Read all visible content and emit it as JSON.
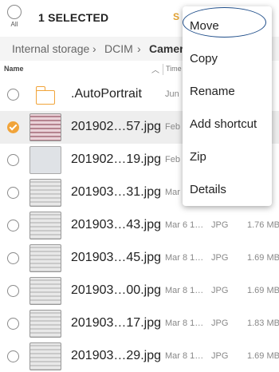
{
  "header": {
    "all_label": "All",
    "selected_text": "1 SELECTED",
    "share_partial": "S"
  },
  "breadcrumb": {
    "items": [
      "Internal storage",
      "DCIM",
      "Camer"
    ],
    "separator": "›"
  },
  "columns": {
    "name": "Name",
    "time": "Time"
  },
  "files": [
    {
      "name": ".AutoPortrait",
      "date": "Jun",
      "type": "",
      "size": "",
      "thumb": "folder",
      "selected": false
    },
    {
      "name": "201902…57.jpg",
      "date": "Feb",
      "type": "",
      "size": "",
      "thumb": "pink",
      "selected": true
    },
    {
      "name": "201902…19.jpg",
      "date": "Feb",
      "type": "",
      "size": "",
      "thumb": "plain",
      "selected": false
    },
    {
      "name": "201903…31.jpg",
      "date": "Mar",
      "type": "",
      "size": "",
      "thumb": "doc",
      "selected": false
    },
    {
      "name": "201903…43.jpg",
      "date": "Mar 6 1…",
      "type": "JPG",
      "size": "1.76 MB",
      "thumb": "doc",
      "selected": false
    },
    {
      "name": "201903…45.jpg",
      "date": "Mar 8 1…",
      "type": "JPG",
      "size": "1.69 MB",
      "thumb": "doc",
      "selected": false
    },
    {
      "name": "201903…00.jpg",
      "date": "Mar 8 1…",
      "type": "JPG",
      "size": "1.69 MB",
      "thumb": "doc",
      "selected": false
    },
    {
      "name": "201903…17.jpg",
      "date": "Mar 8 1…",
      "type": "JPG",
      "size": "1.83 MB",
      "thumb": "doc",
      "selected": false
    },
    {
      "name": "201903…29.jpg",
      "date": "Mar 8 1…",
      "type": "JPG",
      "size": "1.69 MB",
      "thumb": "doc",
      "selected": false
    }
  ],
  "menu": {
    "items": [
      "Move",
      "Copy",
      "Rename",
      "Add shortcut",
      "Zip",
      "Details"
    ],
    "highlighted": "Move"
  },
  "colors": {
    "accent": "#f1a43a",
    "highlight_ring": "#1f4e8a"
  }
}
